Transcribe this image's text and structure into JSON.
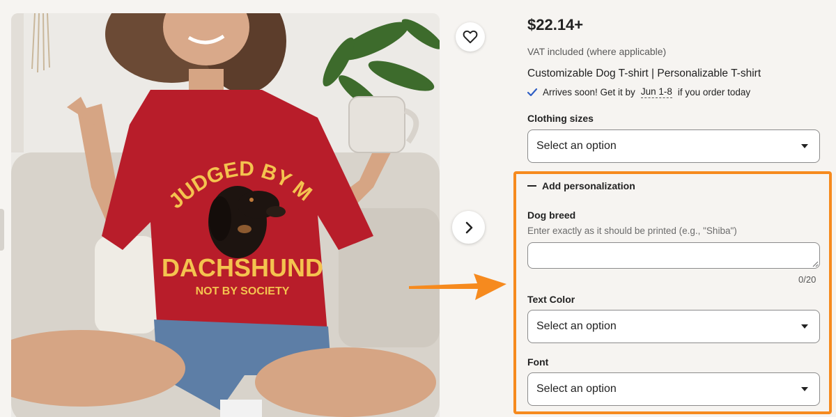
{
  "product": {
    "price": "$22.14+",
    "vat_note": "VAT included (where applicable)",
    "title": "Customizable Dog T-shirt | Personalizable T-shirt",
    "arrival": {
      "prefix": "Arrives soon! Get it by",
      "date": "Jun 1-8",
      "suffix": "if you order today"
    }
  },
  "image": {
    "shirt_text_top": "JUDGED BY MY",
    "shirt_text_main": "DACHSHUND",
    "shirt_text_bottom": "NOT BY SOCIETY",
    "favorite_icon": "heart-icon",
    "next_icon": "chevron-right-icon"
  },
  "options": {
    "clothing_sizes": {
      "label": "Clothing sizes",
      "value": "Select an option"
    },
    "personalization_toggle": "Add personalization",
    "dog_breed": {
      "label": "Dog breed",
      "hint": "Enter exactly as it should be printed (e.g., \"Shiba\")",
      "value": "",
      "counter": "0/20"
    },
    "text_color": {
      "label": "Text Color",
      "value": "Select an option"
    },
    "font": {
      "label": "Font",
      "value": "Select an option"
    }
  },
  "colors": {
    "highlight": "#f68a1e",
    "shirt": "#b81d2a",
    "shirt_print": "#f4c34f",
    "check": "#2f5ec4"
  }
}
